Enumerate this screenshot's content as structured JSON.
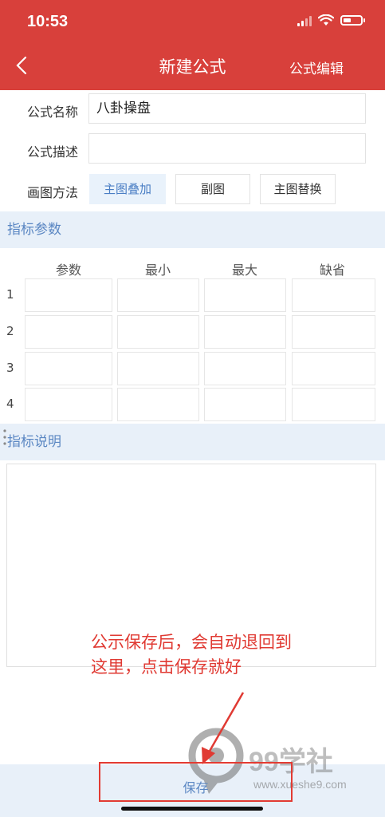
{
  "status_bar": {
    "time": "10:53"
  },
  "header": {
    "title": "新建公式",
    "edit_label": "公式编辑"
  },
  "form": {
    "name_label": "公式名称",
    "name_value": "八卦操盘",
    "desc_label": "公式描述",
    "desc_value": "",
    "draw_label": "画图方法",
    "draw_modes": [
      "主图叠加",
      "副图",
      "主图替换"
    ],
    "selected_mode": "主图叠加"
  },
  "params": {
    "section_title": "指标参数",
    "columns": [
      "参数",
      "最小",
      "最大",
      "缺省"
    ],
    "rows": [
      "1",
      "2",
      "3",
      "4"
    ]
  },
  "description": {
    "section_title": "指标说明",
    "text": ""
  },
  "annotation": {
    "line1": "公示保存后，会自动退回到",
    "line2": "这里，点击保存就好",
    "color": "#e03a33"
  },
  "footer": {
    "save_label": "保存"
  },
  "watermark": {
    "brand": "99学社",
    "url": "www.xueshe9.com"
  },
  "colors": {
    "header_bg": "#d8403b",
    "accent_blue": "#5b87c3",
    "section_bg": "#e8f0f9"
  }
}
